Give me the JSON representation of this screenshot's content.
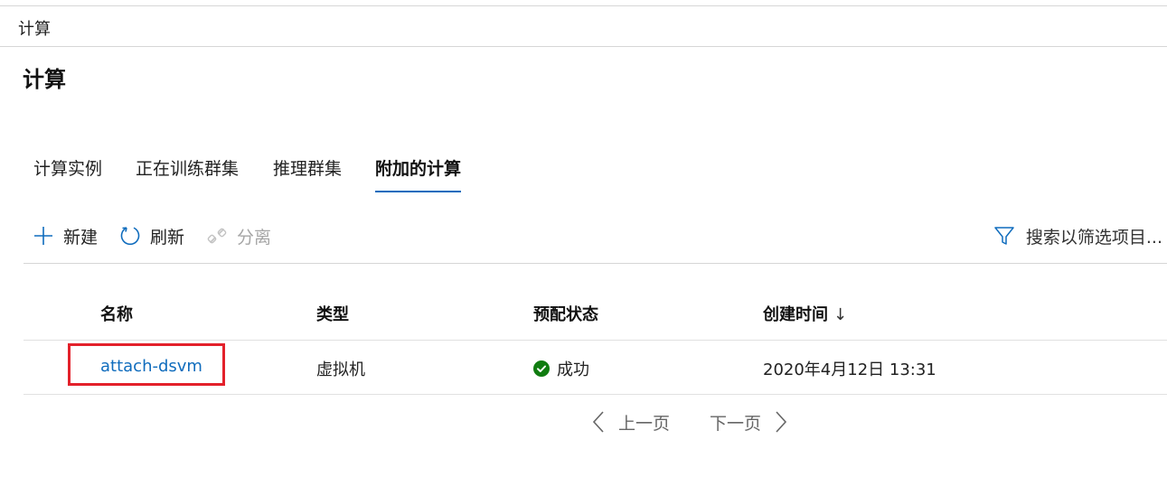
{
  "breadcrumb": {
    "label": "计算"
  },
  "page": {
    "title": "计算"
  },
  "tabs": [
    {
      "label": "计算实例",
      "active": false
    },
    {
      "label": "正在训练群集",
      "active": false
    },
    {
      "label": "推理群集",
      "active": false
    },
    {
      "label": "附加的计算",
      "active": true
    }
  ],
  "toolbar": {
    "new_label": "新建",
    "refresh_label": "刷新",
    "detach_label": "分离",
    "search_placeholder": "搜索以筛选项目..."
  },
  "table": {
    "columns": [
      "名称",
      "类型",
      "预配状态",
      "创建时间"
    ],
    "sort_indicator": "↓",
    "rows": [
      {
        "name": "attach-dsvm",
        "type": "虚拟机",
        "status": "成功",
        "created": "2020年4月12日 13:31"
      }
    ]
  },
  "pagination": {
    "prev_label": "上一页",
    "next_label": "下一页"
  },
  "colors": {
    "accent": "#0f6cbd",
    "success": "#107c10",
    "highlight": "#e3212b"
  }
}
